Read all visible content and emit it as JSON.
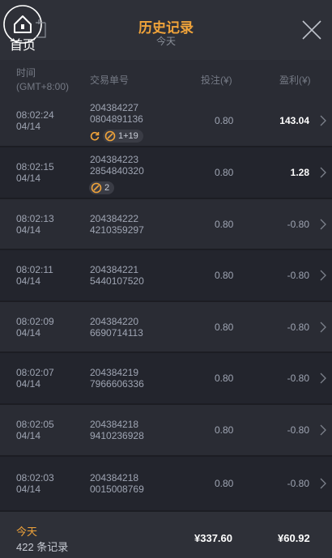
{
  "header": {
    "home_label": "首页",
    "title": "历史记录",
    "subtitle": "今天"
  },
  "columns": {
    "time": "时间",
    "timezone": "(GMT+8:00)",
    "order": "交易单号",
    "bet": "投注(¥)",
    "profit": "盈利(¥)"
  },
  "rows": [
    {
      "time": "08:02:24",
      "date": "04/14",
      "order1": "204384227",
      "order2": "0804891136",
      "bet": "0.80",
      "profit": "143.04",
      "win": true,
      "badge": "1+19",
      "badge_icons": [
        "refresh-icon",
        "ball-icon"
      ]
    },
    {
      "time": "08:02:15",
      "date": "04/14",
      "order1": "204384223",
      "order2": "2854840320",
      "bet": "0.80",
      "profit": "1.28",
      "win": true,
      "badge": "2",
      "badge_icons": [
        "ball-icon"
      ]
    },
    {
      "time": "08:02:13",
      "date": "04/14",
      "order1": "204384222",
      "order2": "4210359297",
      "bet": "0.80",
      "profit": "-0.80",
      "win": false
    },
    {
      "time": "08:02:11",
      "date": "04/14",
      "order1": "204384221",
      "order2": "5440107520",
      "bet": "0.80",
      "profit": "-0.80",
      "win": false
    },
    {
      "time": "08:02:09",
      "date": "04/14",
      "order1": "204384220",
      "order2": "6690714113",
      "bet": "0.80",
      "profit": "-0.80",
      "win": false
    },
    {
      "time": "08:02:07",
      "date": "04/14",
      "order1": "204384219",
      "order2": "7966606336",
      "bet": "0.80",
      "profit": "-0.80",
      "win": false
    },
    {
      "time": "08:02:05",
      "date": "04/14",
      "order1": "204384218",
      "order2": "9410236928",
      "bet": "0.80",
      "profit": "-0.80",
      "win": false
    },
    {
      "time": "08:02:03",
      "date": "04/14",
      "order1": "204384218",
      "order2": "0015008769",
      "bet": "0.80",
      "profit": "-0.80",
      "win": false
    }
  ],
  "footer": {
    "label": "今天",
    "count": "422 条记录",
    "total_bet": "¥337.60",
    "total_profit": "¥60.92"
  },
  "colors": {
    "accent": "#f0a33a",
    "background": "#23252d",
    "header_bg": "#2e3038"
  }
}
